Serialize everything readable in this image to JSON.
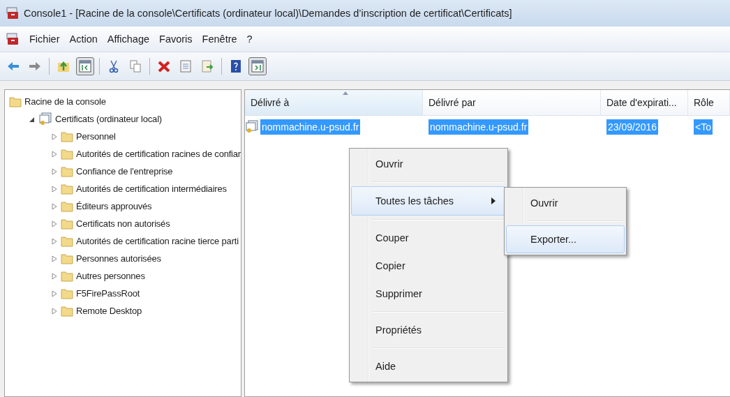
{
  "window": {
    "title": "Console1 - [Racine de la console\\Certificats (ordinateur local)\\Demandes d’inscription de certificat\\Certificats]"
  },
  "menu_bar": [
    "Fichier",
    "Action",
    "Affichage",
    "Favoris",
    "Fenêtre",
    "?"
  ],
  "toolbar": [
    {
      "kind": "back"
    },
    {
      "kind": "forward"
    },
    {
      "kind": "separator"
    },
    {
      "kind": "up"
    },
    {
      "kind": "tree-pane",
      "pressed": true
    },
    {
      "kind": "separator"
    },
    {
      "kind": "cut"
    },
    {
      "kind": "copy"
    },
    {
      "kind": "separator"
    },
    {
      "kind": "delete"
    },
    {
      "kind": "properties"
    },
    {
      "kind": "export"
    },
    {
      "kind": "separator"
    },
    {
      "kind": "help"
    },
    {
      "kind": "action-pane",
      "pressed": true
    }
  ],
  "tree": [
    {
      "label": "Racine de la console",
      "kind": "folder",
      "children": [
        {
          "label": "Certificats (ordinateur local)",
          "kind": "certificates",
          "expanded": true,
          "children": [
            {
              "label": "Personnel",
              "kind": "folder",
              "expanded": false
            },
            {
              "label": "Autorités de certification racines de confiar",
              "kind": "folder",
              "expanded": false
            },
            {
              "label": "Confiance de l'entreprise",
              "kind": "folder",
              "expanded": false
            },
            {
              "label": "Autorités de certification intermédiaires",
              "kind": "folder",
              "expanded": false
            },
            {
              "label": "Éditeurs approuvés",
              "kind": "folder",
              "expanded": false
            },
            {
              "label": "Certificats non autorisés",
              "kind": "folder",
              "expanded": false
            },
            {
              "label": "Autorités de certification racine tierce parti",
              "kind": "folder",
              "expanded": false
            },
            {
              "label": "Personnes autorisées",
              "kind": "folder",
              "expanded": false
            },
            {
              "label": "Autres personnes",
              "kind": "folder",
              "expanded": false
            },
            {
              "label": "F5FirePassRoot",
              "kind": "folder",
              "expanded": false
            },
            {
              "label": "Remote Desktop",
              "kind": "folder",
              "expanded": false
            }
          ]
        }
      ]
    }
  ],
  "table": {
    "columns": [
      {
        "label": "Délivré à",
        "sorted": true
      },
      {
        "label": "Délivré par",
        "sorted": false
      },
      {
        "label": "Date d'expirati...",
        "sorted": false
      },
      {
        "label": "Rôle",
        "sorted": false
      }
    ],
    "rows": [
      {
        "selected": true,
        "cells": [
          "nommachine.u-psud.fr",
          "nommachine.u-psud.fr",
          "23/09/2016",
          "<To"
        ]
      }
    ]
  },
  "context_menu": {
    "items": [
      {
        "kind": "item",
        "label": "Ouvrir",
        "selected": false
      },
      {
        "kind": "separator"
      },
      {
        "kind": "submenu",
        "label": "Toutes les tâches",
        "selected": true
      },
      {
        "kind": "separator"
      },
      {
        "kind": "item",
        "label": "Couper",
        "selected": false
      },
      {
        "kind": "item",
        "label": "Copier",
        "selected": false
      },
      {
        "kind": "item",
        "label": "Supprimer",
        "selected": false
      },
      {
        "kind": "separator"
      },
      {
        "kind": "item",
        "label": "Propriétés",
        "selected": false
      },
      {
        "kind": "separator"
      },
      {
        "kind": "item",
        "label": "Aide",
        "selected": false
      }
    ],
    "submenu": [
      {
        "kind": "item",
        "label": "Ouvrir",
        "selected": false
      },
      {
        "kind": "separator"
      },
      {
        "kind": "item",
        "label": "Exporter...",
        "selected": true
      }
    ]
  }
}
